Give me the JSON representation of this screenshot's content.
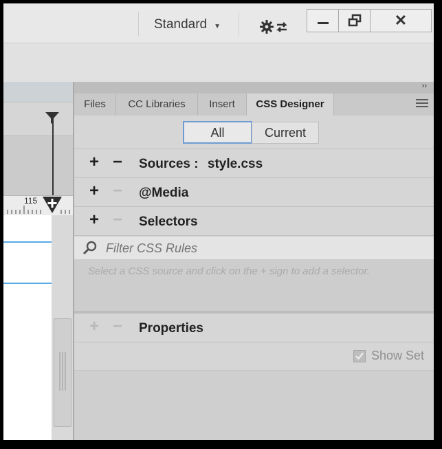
{
  "window": {
    "workspace_label": "Standard",
    "icons": {
      "workspace_caret": "caret-down-icon",
      "sync": "gear-sync-icon",
      "minimize": "minimize-icon",
      "restore": "restore-icon",
      "close": "close-icon"
    }
  },
  "document": {
    "ruler_label": "115",
    "icons": {
      "filter": "filter-icon",
      "ruler_marker": "plus-marker-icon"
    }
  },
  "panel": {
    "collapse_label": "››",
    "tabs": [
      {
        "label": "Files"
      },
      {
        "label": "CC Libraries"
      },
      {
        "label": "Insert"
      },
      {
        "label": "CSS Designer"
      }
    ],
    "active_tab": "CSS Designer",
    "filter_buttons": {
      "all": "All",
      "current": "Current",
      "selected": "All"
    },
    "sections": {
      "sources": {
        "label": "Sources :",
        "value": "style.css"
      },
      "media": {
        "label": "@Media"
      },
      "selectors": {
        "label": "Selectors"
      },
      "properties": {
        "label": "Properties"
      }
    },
    "filter_css": {
      "placeholder": "Filter CSS Rules"
    },
    "hint": "Select a CSS source and click on the + sign to add a selector.",
    "show_set": {
      "label": "Show Set",
      "checked": true
    },
    "colors": {
      "active_border": "#6d9bd2",
      "guide": "#5aa9e6"
    }
  }
}
